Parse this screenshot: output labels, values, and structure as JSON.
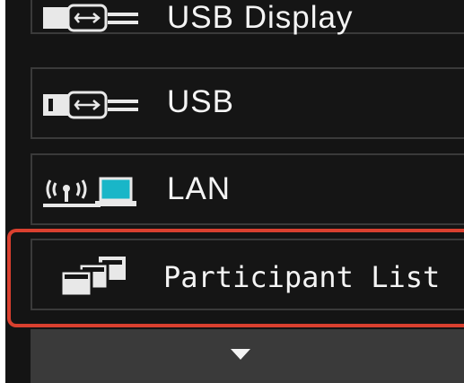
{
  "menu": {
    "items": [
      {
        "id": "usb-display",
        "label": "USB Display",
        "icon": "usb-connector-icon"
      },
      {
        "id": "usb",
        "label": "USB",
        "icon": "usb-connector-icon"
      },
      {
        "id": "lan",
        "label": "LAN",
        "icon": "wireless-lan-icon"
      },
      {
        "id": "participant-list",
        "label": "Participant List",
        "icon": "stacked-windows-icon",
        "highlighted": true
      }
    ],
    "scroll_icon": "chevron-down-icon"
  },
  "colors": {
    "panel_background": "#141414",
    "text": "#f4f4f4",
    "highlight_frame": "#d9402f",
    "lan_screen": "#19b6c8",
    "scroll_strip": "#3a3a3a"
  }
}
